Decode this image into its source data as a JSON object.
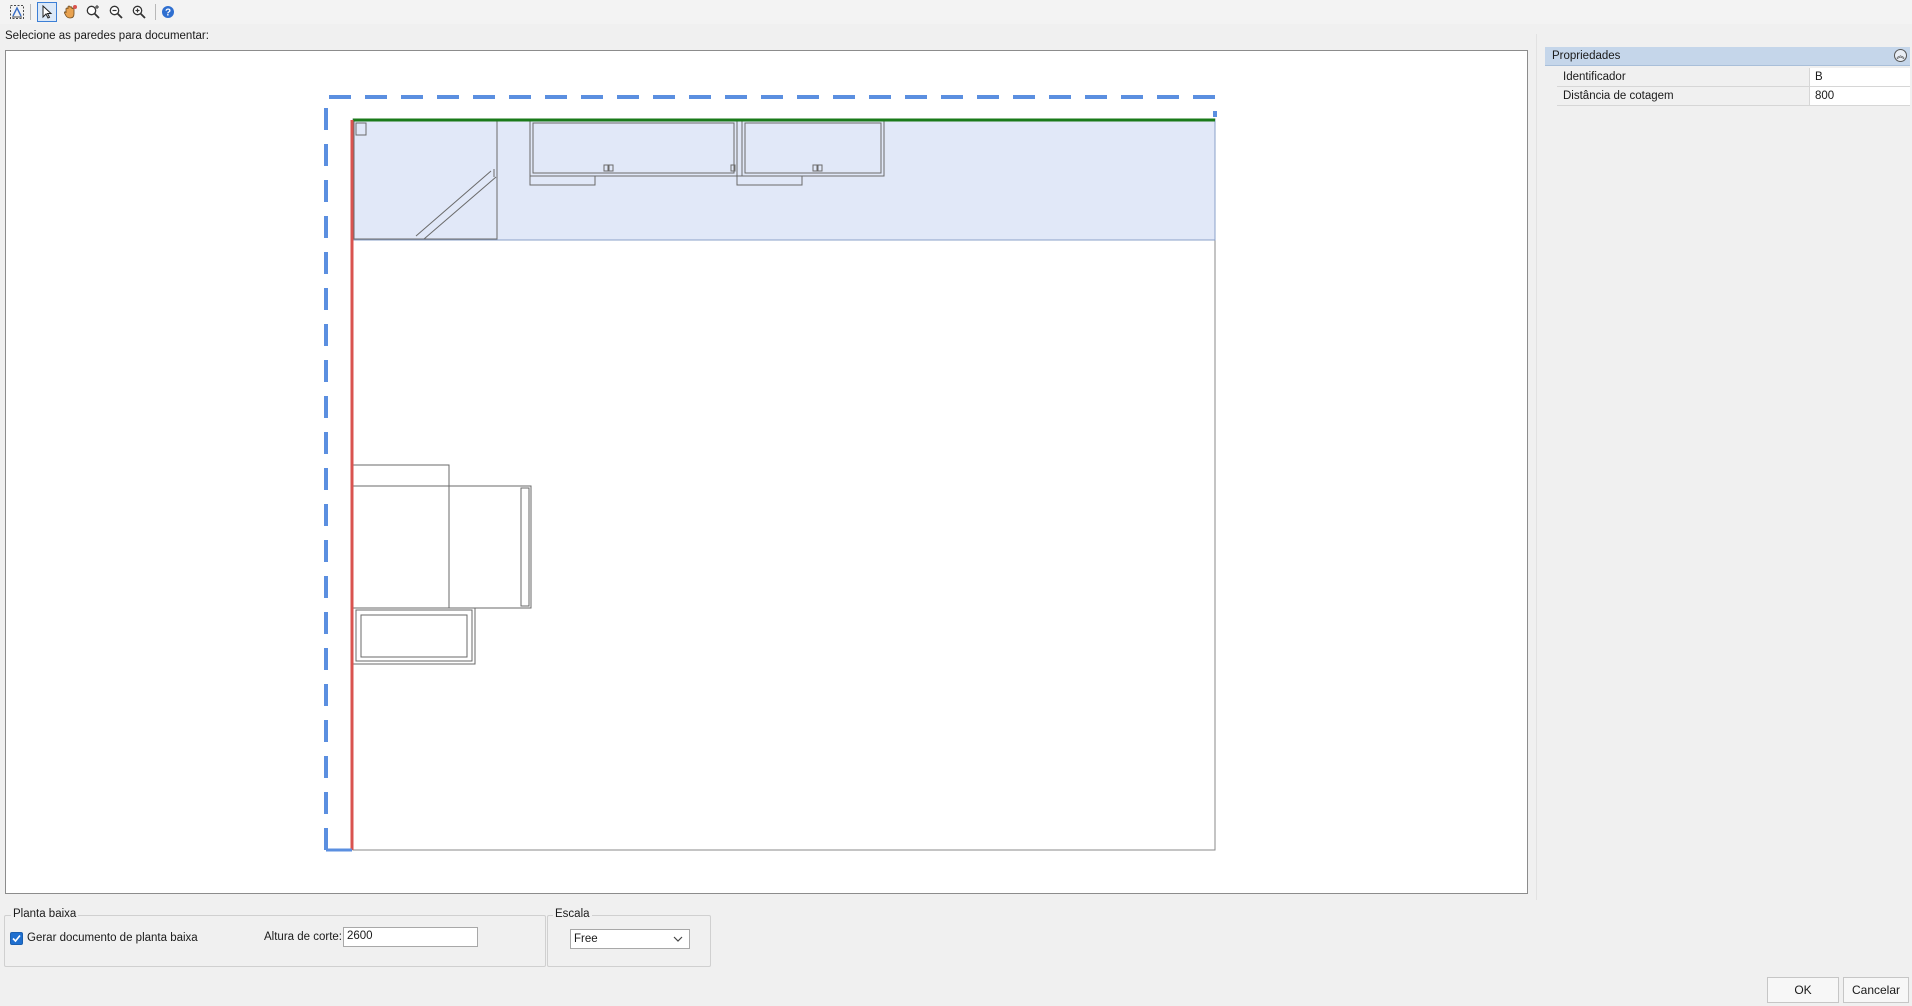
{
  "toolbar": {
    "tools": [
      {
        "icon": "select-walls-icon"
      },
      {
        "icon": "pointer-icon"
      },
      {
        "icon": "pan-hand-icon"
      },
      {
        "icon": "zoom-window-icon"
      },
      {
        "icon": "zoom-out-icon"
      },
      {
        "icon": "zoom-in-icon"
      },
      {
        "icon": "help-icon"
      }
    ]
  },
  "instruction": "Selecione as paredes para documentar:",
  "properties": {
    "title": "Propriedades",
    "rows": [
      {
        "name": "Identificador",
        "value": "B"
      },
      {
        "name": "Distância de cotagem",
        "value": "800"
      }
    ]
  },
  "planta_baixa": {
    "title": "Planta baixa",
    "checkbox_label": "Gerar documento de planta baixa",
    "checked": true,
    "altura_label": "Altura de corte:",
    "altura_value": "2600"
  },
  "escala": {
    "title": "Escala",
    "selected": "Free"
  },
  "buttons": {
    "ok": "OK",
    "cancel": "Cancelar"
  },
  "colors": {
    "selection_dashed": "#5b8fe0",
    "selected_wall": "#1a7a1a",
    "highlight_wall": "#d9534f",
    "highlight_fill": "#e1e8f8",
    "accent": "#1f6fcf"
  }
}
